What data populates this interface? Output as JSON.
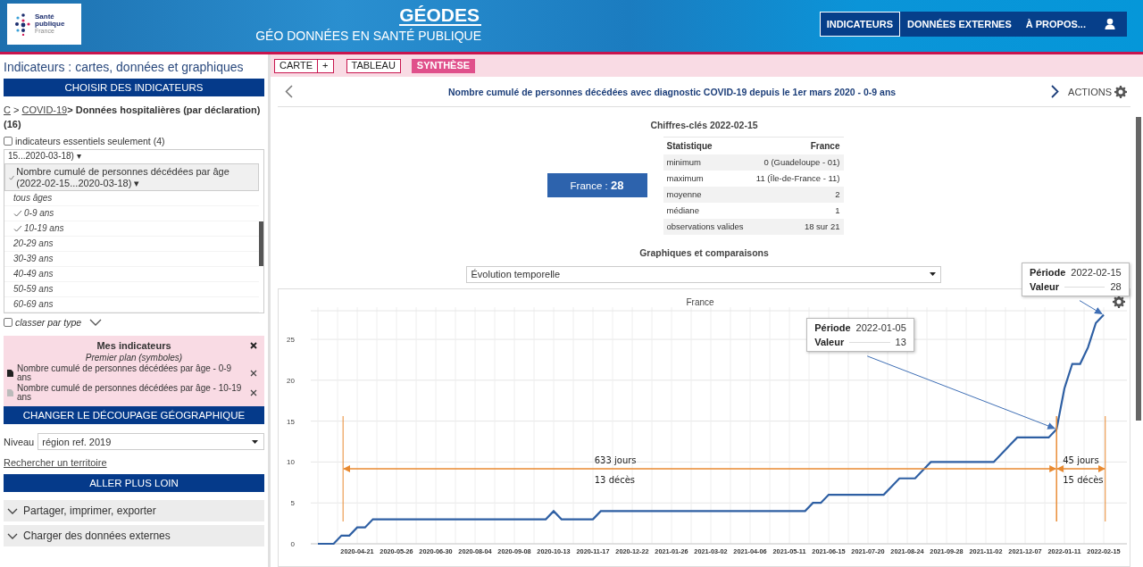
{
  "header": {
    "logo": {
      "lines": [
        "Santé",
        "publique",
        "France"
      ]
    },
    "title": "GÉODES",
    "subtitle": "GÉO DONNÉES EN SANTÉ PUBLIQUE",
    "nav": [
      {
        "label": "INDICATEURS",
        "selected": true
      },
      {
        "label": "DONNÉES EXTERNES",
        "selected": false
      },
      {
        "label": "À PROPOS...",
        "selected": false
      }
    ]
  },
  "sidebar": {
    "title": "Indicateurs : cartes, données et graphiques",
    "choose_header": "CHOISIR DES INDICATEURS",
    "breadcrumb": [
      {
        "text": "C",
        "kind": "link"
      },
      {
        "text": ">",
        "kind": "sep"
      },
      {
        "text": "COVID-19",
        "kind": "link"
      },
      {
        "text": "> Données hospitalières (par déclaration) (16)",
        "kind": "current"
      }
    ],
    "essentials_filter": {
      "label": "indicateurs essentiels seulement (4)",
      "checked": false
    },
    "indicator_list": [
      {
        "text": "15...2020-03-18) ▾",
        "checked": false,
        "selected": false
      },
      {
        "text": "Nombre cumulé de personnes décédées par âge (2022-02-15...2020-03-18) ▾",
        "checked": true,
        "selected": true,
        "children": [
          {
            "text": "tous âges",
            "checked": false
          },
          {
            "text": "0-9 ans",
            "checked": true
          },
          {
            "text": "10-19 ans",
            "checked": true
          },
          {
            "text": "20-29 ans",
            "checked": false
          },
          {
            "text": "30-39 ans",
            "checked": false
          },
          {
            "text": "40-49 ans",
            "checked": false
          },
          {
            "text": "50-59 ans",
            "checked": false
          },
          {
            "text": "60-69 ans",
            "checked": false
          }
        ]
      }
    ],
    "sort_by_type": {
      "label": "classer par type",
      "checked": false
    },
    "my_indicators": {
      "title": "Mes indicateurs",
      "subtitle": "Premier plan (symboles)",
      "items": [
        {
          "text": "Nombre cumulé de personnes décédées par âge - 0-9 ans",
          "kind": "primary"
        },
        {
          "text": "Nombre cumulé de personnes décédées par âge - 10-19 ans",
          "kind": "secondary"
        }
      ]
    },
    "geo_header": "CHANGER LE DÉCOUPAGE GÉOGRAPHIQUE",
    "level": {
      "label": "Niveau",
      "value": "région ref. 2019"
    },
    "search_link": "Rechercher un territoire",
    "more_header": "ALLER PLUS LOIN",
    "accordions": [
      {
        "label": "Partager, imprimer, exporter",
        "expanded": false
      },
      {
        "label": "Charger des données externes",
        "expanded": false
      }
    ]
  },
  "main": {
    "view_tabs": [
      {
        "label": "CARTE",
        "selected": false
      },
      {
        "label": "+",
        "selected": false
      },
      {
        "label": "TABLEAU",
        "selected": false
      },
      {
        "label": "SYNTHÈSE",
        "selected": true
      }
    ],
    "indicator_title": "Nombre cumulé de personnes décédées avec diagnostic COVID-19 depuis le 1er mars 2020 - 0-9 ans",
    "actions_label": "ACTIONS",
    "key_figures": {
      "title": "Chiffres-clés 2022-02-15",
      "summary": "France : **28**",
      "table": {
        "columns": [
          "Statistique",
          "France"
        ],
        "rows": [
          [
            "minimum",
            "0 (Guadeloupe - 01)"
          ],
          [
            "maximum",
            "11 (Île-de-France - 11)"
          ],
          [
            "moyenne",
            "2"
          ],
          [
            "médiane",
            "1"
          ],
          [
            "observations valides",
            "18 sur 21"
          ]
        ]
      }
    },
    "charts_title": "Graphiques et comparaisons",
    "chart_type": "Évolution temporelle",
    "chart_panel": {
      "chart_data": {
        "type": "line",
        "title": "France",
        "categories": [
          null,
          null,
          null,
          null,
          null,
          "2020-04-21",
          null,
          null,
          null,
          null,
          "2020-05-26",
          null,
          null,
          null,
          null,
          "2020-06-30",
          null,
          null,
          null,
          null,
          "2020-08-04",
          null,
          null,
          null,
          null,
          "2020-09-08",
          null,
          null,
          null,
          null,
          "2020-10-13",
          null,
          null,
          null,
          null,
          "2020-11-17",
          null,
          null,
          null,
          null,
          "2020-12-22",
          null,
          null,
          null,
          null,
          "2021-01-26",
          null,
          null,
          null,
          null,
          "2021-03-02",
          null,
          null,
          null,
          null,
          "2021-04-06",
          null,
          null,
          null,
          null,
          "2021-05-11",
          null,
          null,
          null,
          null,
          "2021-06-15",
          null,
          null,
          null,
          null,
          "2021-07-20",
          null,
          null,
          null,
          null,
          "2021-08-24",
          null,
          null,
          null,
          null,
          "2021-09-28",
          null,
          null,
          null,
          null,
          "2021-11-02",
          null,
          null,
          null,
          null,
          "2021-12-07",
          null,
          null,
          null,
          null,
          "2022-01-11",
          null,
          null,
          null,
          null,
          "2022-02-15"
        ],
        "series": [
          {
            "color": "#2e5fa3",
            "values": [
              0,
              0,
              0,
              1,
              1,
              2,
              2,
              3,
              3,
              3,
              3,
              3,
              3,
              3,
              3,
              3,
              3,
              3,
              3,
              3,
              3,
              3,
              3,
              3,
              3,
              3,
              3,
              3,
              3,
              3,
              4,
              3,
              3,
              3,
              3,
              3,
              4,
              4,
              4,
              4,
              4,
              4,
              4,
              4,
              4,
              4,
              4,
              4,
              4,
              4,
              4,
              4,
              4,
              4,
              4,
              4,
              4,
              4,
              4,
              4,
              4,
              4,
              4,
              5,
              5,
              6,
              6,
              6,
              6,
              6,
              6,
              6,
              6,
              7,
              8,
              8,
              8,
              9,
              10,
              10,
              10,
              10,
              10,
              10,
              10,
              10,
              10,
              11,
              12,
              13,
              13,
              13,
              13,
              13,
              14,
              19,
              22,
              22,
              24,
              27,
              28
            ]
          }
        ],
        "grid": true,
        "ylim": [
          0,
          28.5
        ],
        "yticks": [
          0,
          5,
          10,
          15,
          20,
          25
        ],
        "annotations": [
          "633 jours",
          "13 décès",
          "45 jours",
          "15 décès"
        ]
      },
      "tooltips": [
        {
          "period_label": "Période",
          "period": "2022-01-05",
          "value_label": "Valeur",
          "value": "13"
        },
        {
          "period_label": "Période",
          "period": "2022-02-15",
          "value_label": "Valeur",
          "value": "28"
        }
      ]
    }
  }
}
